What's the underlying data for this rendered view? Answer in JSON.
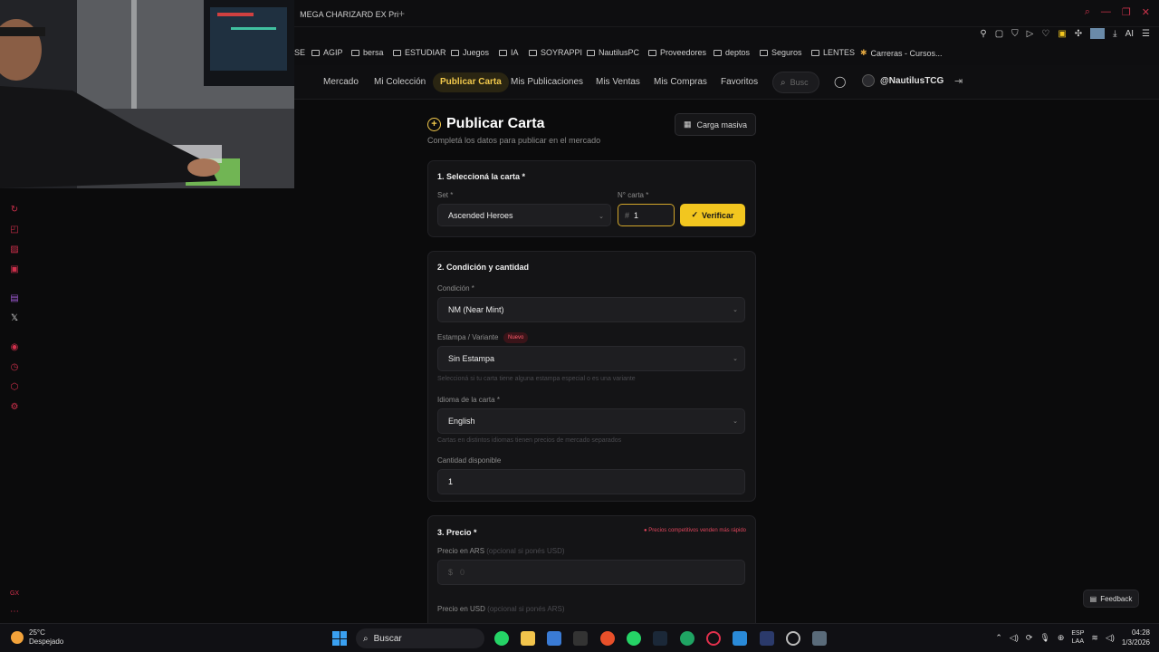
{
  "browser": {
    "tab_title": "MEGA CHARIZARD EX Pri",
    "bookmarks": [
      "SE",
      "AGIP",
      "bersa",
      "ESTUDIAR",
      "Juegos",
      "IA",
      "SOYRAPPI",
      "NautilusPC",
      "Proveedores",
      "deptos",
      "Seguros",
      "LENTES",
      "Carreras - Cursos..."
    ],
    "ext_label": "AI"
  },
  "nav": {
    "links": [
      "Mercado",
      "Mi Colección",
      "Publicar Carta",
      "Mis Publicaciones",
      "Mis Ventas",
      "Mis Compras",
      "Favoritos"
    ],
    "search_placeholder": "Busc",
    "username": "@NautilusTCG"
  },
  "page": {
    "title": "Publicar Carta",
    "subtitle": "Completá los datos para publicar en el mercado",
    "bulk_button": "Carga masiva"
  },
  "section1": {
    "title": "1. Seleccioná la carta *",
    "set_label": "Set *",
    "set_value": "Ascended Heroes",
    "number_label": "N° carta *",
    "number_prefix": "#",
    "number_value": "1",
    "verify_button": "Verificar"
  },
  "section2": {
    "title": "2. Condición y cantidad",
    "condition_label": "Condición *",
    "condition_value": "NM (Near Mint)",
    "variant_label": "Estampa / Variante",
    "variant_badge": "Nuevo",
    "variant_value": "Sin Estampa",
    "variant_hint": "Seleccioná si tu carta tiene alguna estampa especial o es una variante",
    "language_label": "Idioma de la carta *",
    "language_value": "English",
    "language_hint": "Cartas en distintos idiomas tienen precios de mercado separados",
    "quantity_label": "Cantidad disponible",
    "quantity_value": "1"
  },
  "section3": {
    "title": "3. Precio *",
    "note": "Precios competitivos venden más rápido",
    "ars_label": "Precio en ARS",
    "ars_optional": "(opcional si ponés USD)",
    "ars_prefix": "$",
    "ars_placeholder": "0",
    "usd_label": "Precio en USD",
    "usd_optional": "(opcional si ponés ARS)"
  },
  "feedback_button": "Feedback",
  "taskbar": {
    "weather_temp": "25°C",
    "weather_desc": "Despejado",
    "search_label": "Buscar",
    "lang_top": "ESP",
    "lang_bottom": "LAA",
    "time": "04:28",
    "date": "1/3/2026"
  },
  "colors": {
    "accent": "#f2c61f",
    "danger": "#e0455c",
    "background": "#0b0b0c",
    "card": "#141416"
  }
}
